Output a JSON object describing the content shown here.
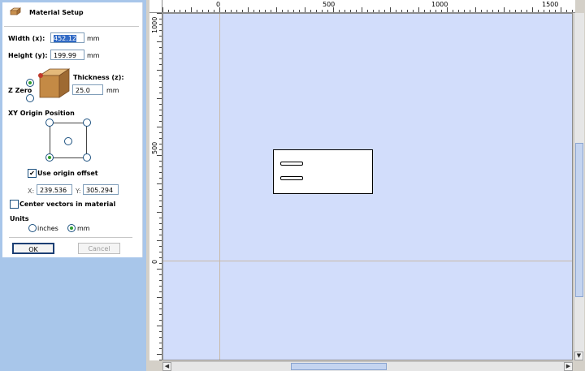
{
  "dialog": {
    "title": "Material Setup",
    "width": {
      "label": "Width (x):",
      "value": "452.12",
      "unit": "mm"
    },
    "height": {
      "label": "Height (y):",
      "value": "199.99",
      "unit": "mm"
    },
    "zzero_label": "Z Zero",
    "zzero_selected": "top",
    "thickness": {
      "label": "Thickness (z):",
      "value": "25.0",
      "unit": "mm"
    },
    "xy_origin_label": "XY Origin Position",
    "xy_origin_selected": "bottom-left",
    "use_origin_offset": {
      "label": "Use origin offset",
      "checked": true
    },
    "offset_x": {
      "label": "X:",
      "value": "239.536"
    },
    "offset_y": {
      "label": "Y:",
      "value": "305.294"
    },
    "center_vectors": {
      "label": "Center vectors in material",
      "checked": false
    },
    "units": {
      "label": "Units",
      "inches": "inches",
      "mm": "mm",
      "selected": "mm"
    },
    "ok_label": "OK",
    "cancel_label": "Cancel"
  },
  "rulers": {
    "horizontal_labels": [
      "0",
      "500",
      "1000",
      "1500"
    ],
    "vertical_labels": [
      "1000",
      "500",
      "0"
    ]
  },
  "colors": {
    "left_background": "#a8c6ea",
    "canvas": "#d2ddfb",
    "origin_dot": "#2f9e2f",
    "marker": "#c0392b"
  }
}
